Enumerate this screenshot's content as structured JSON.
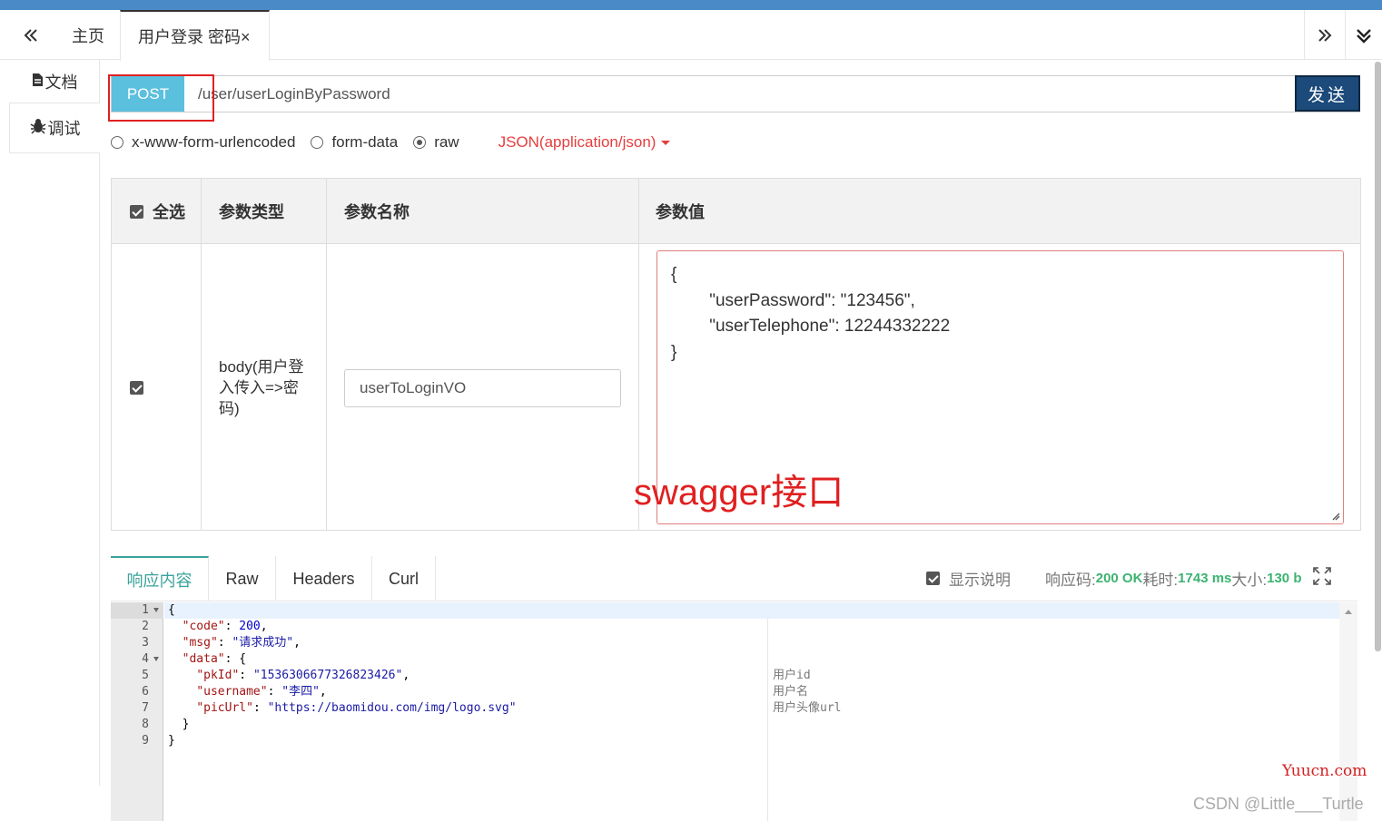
{
  "tabs": {
    "home": "主页",
    "active": "用户登录 密码×"
  },
  "sidebar": {
    "docs": "文档",
    "debug": "调试"
  },
  "request": {
    "method": "POST",
    "url": "/user/userLoginByPassword",
    "send": "发送"
  },
  "content_types": {
    "opt1": "x-www-form-urlencoded",
    "opt2": "form-data",
    "opt3": "raw",
    "selected": "raw",
    "json_type": "JSON(application/json)"
  },
  "params": {
    "col_select_all": "全选",
    "col_type": "参数类型",
    "col_name": "参数名称",
    "col_value": "参数值",
    "row_type": "body(用户登入传入=>密码)",
    "row_name": "userToLoginVO",
    "row_value": "{\n        \"userPassword\": \"123456\",\n        \"userTelephone\": 12244332222\n}"
  },
  "annotation": "swagger接口",
  "response": {
    "tabs": [
      "响应内容",
      "Raw",
      "Headers",
      "Curl"
    ],
    "show_desc": "显示说明",
    "code_label": "响应码:",
    "code_value": "200 OK",
    "time_label": "耗时:",
    "time_value": "1743 ms",
    "size_label": "大小:",
    "size_value": "130 b",
    "line_numbers": [
      "1",
      "2",
      "3",
      "4",
      "5",
      "6",
      "7",
      "8",
      "9"
    ],
    "comments": [
      "用户id",
      "用户名",
      "用户头像url"
    ]
  },
  "watermarks": {
    "site": "Yuucn.com",
    "author": "CSDN @Little___Turtle"
  },
  "colors": {
    "top_bar": "#4a8ac6",
    "method_bg": "#5bc0de",
    "send_bg": "#1c4a7a",
    "accent_green": "#3aa39b",
    "annotation_red": "#e02020"
  }
}
